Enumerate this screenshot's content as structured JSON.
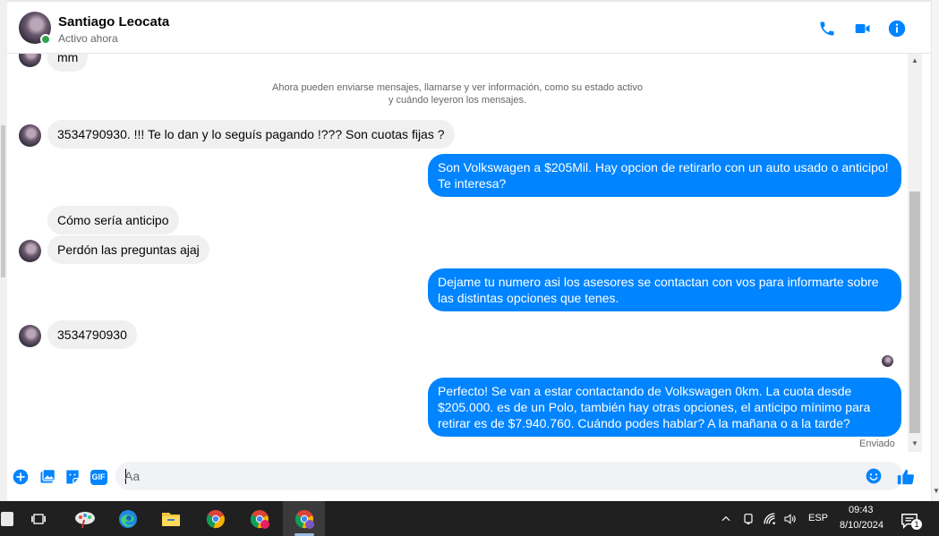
{
  "header": {
    "contact_name": "Santiago Leocata",
    "contact_status": "Activo ahora",
    "icons": [
      "phone-icon",
      "video-icon",
      "info-icon"
    ]
  },
  "conversation": {
    "partial_top_text": "mm",
    "system_note_line1": "Ahora pueden enviarse mensajes, llamarse y ver información, como su estado activo",
    "system_note_line2": "y cuándo leyeron los mensajes.",
    "messages": [
      {
        "from": "them",
        "text": "3534790930. !!! Te lo dan y lo seguís pagando !??? Son cuotas fijas ?"
      },
      {
        "from": "me",
        "text": "Son Volkswagen a $205Mil. Hay opcion de retirarlo con un auto usado o anticipo! Te interesa?"
      },
      {
        "from": "them",
        "text": "Cómo sería anticipo"
      },
      {
        "from": "them",
        "text": "Perdón las preguntas ajaj"
      },
      {
        "from": "me",
        "text": "Dejame tu numero asi los asesores se contactan con vos para informarte sobre las distintas opciones que tenes."
      },
      {
        "from": "them",
        "text": "3534790930"
      },
      {
        "from": "me",
        "text": "Perfecto!  Se van a estar contactando de Volkswagen 0km. La cuota desde $205.000. es de un Polo, también hay otras opciones, el anticipo mínimo para retirar es de $7.940.760. Cuándo podes hablar? A la mañana o a la tarde?"
      }
    ],
    "sent_label": "Enviado"
  },
  "composer": {
    "placeholder": "Aa",
    "icons": [
      "plus-icon",
      "image-icon",
      "sticker-icon",
      "gif-icon",
      "emoji-icon",
      "like-icon"
    ],
    "gif_label": "GIF"
  },
  "taskbar": {
    "language": "ESP",
    "time": "09:43",
    "date": "8/10/2024",
    "notification_count": "1",
    "colors": {
      "accent": "#0084ff",
      "taskbar": "#202020"
    }
  }
}
